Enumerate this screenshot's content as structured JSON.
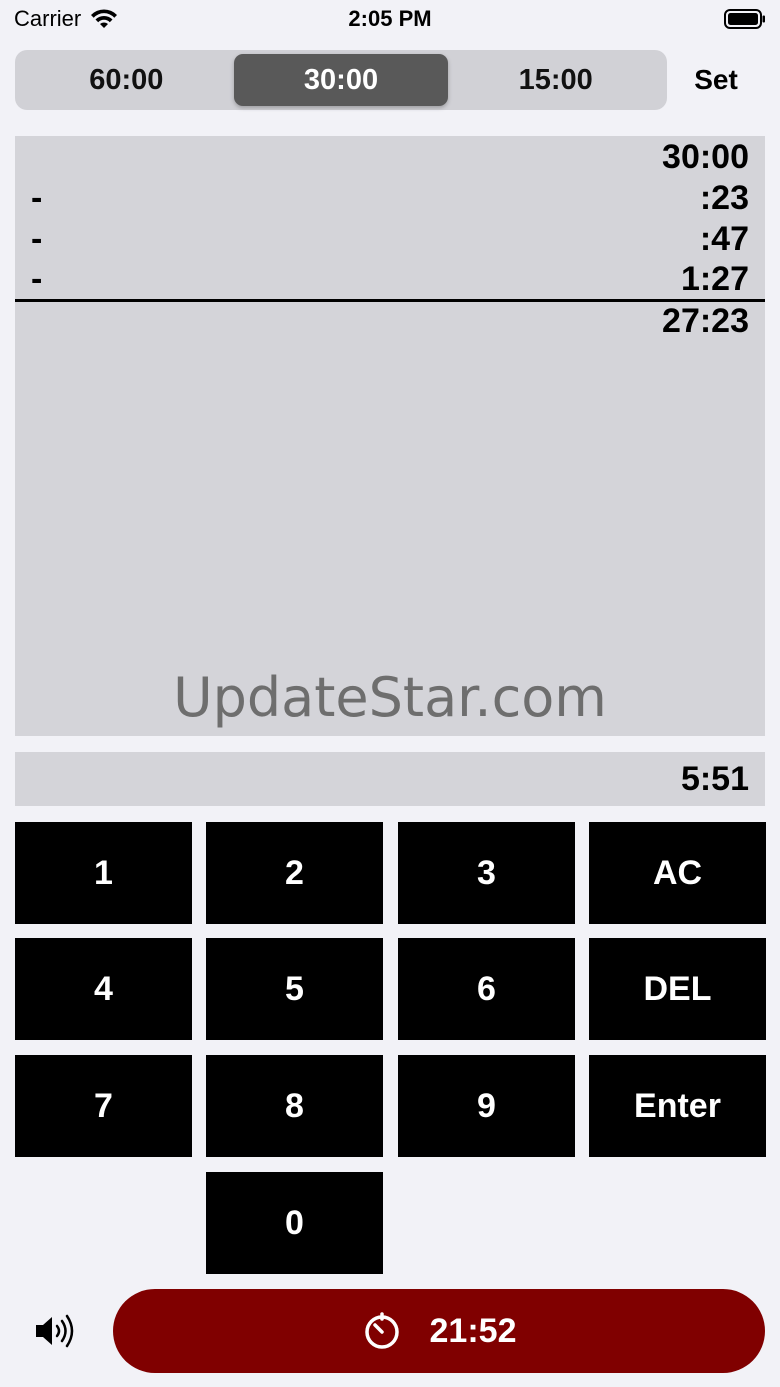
{
  "status_bar": {
    "carrier": "Carrier",
    "time": "2:05 PM"
  },
  "segments": {
    "items": [
      "60:00",
      "30:00",
      "15:00"
    ],
    "selected": "30:00"
  },
  "set_label": "Set",
  "tape": {
    "start": "30:00",
    "entries": [
      {
        "op": "-",
        "value": ":23"
      },
      {
        "op": "-",
        "value": ":47"
      },
      {
        "op": "-",
        "value": "1:27"
      }
    ],
    "result": "27:23"
  },
  "watermark": "UpdateStar.com",
  "display_value": "5:51",
  "keys": {
    "k1": "1",
    "k2": "2",
    "k3": "3",
    "ac": "AC",
    "k4": "4",
    "k5": "5",
    "k6": "6",
    "del": "DEL",
    "k7": "7",
    "k8": "8",
    "k9": "9",
    "enter": "Enter",
    "k0": "0"
  },
  "timer": {
    "time": "21:52",
    "icon": "timer-icon"
  },
  "colors": {
    "timer_bg": "#800000",
    "segment_active": "#595959",
    "key_bg": "#000000"
  }
}
